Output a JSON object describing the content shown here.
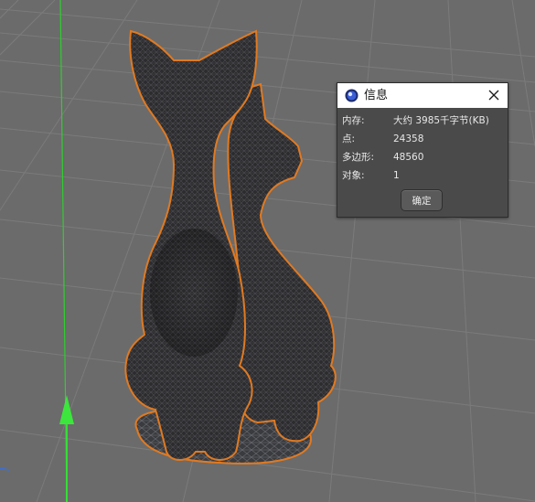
{
  "dialog": {
    "title": "信息",
    "close_icon": "close-icon",
    "app_icon": "cinema4d-logo-icon",
    "rows": [
      {
        "label": "内存:",
        "value": "大约 3985千字节(KB)"
      },
      {
        "label": "点:",
        "value": "24358"
      },
      {
        "label": "多边形:",
        "value": "48560"
      },
      {
        "label": "对象:",
        "value": "1"
      }
    ],
    "ok_label": "确定"
  },
  "viewport": {
    "background_color": "#6b6b6b",
    "grid_color": "#7a7a7a",
    "y_axis_color": "#2fd12f",
    "selection_outline_color": "#e07a22",
    "object": "cat-figurine-mesh"
  }
}
